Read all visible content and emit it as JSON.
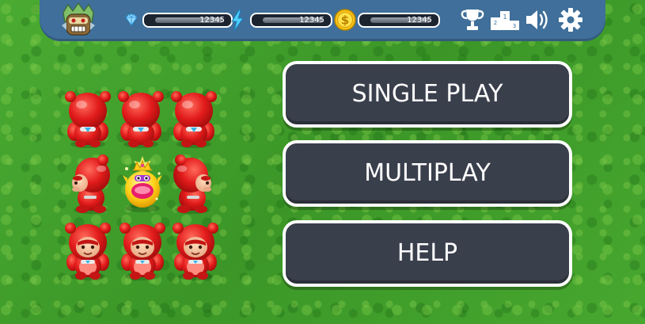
{
  "resources": [
    {
      "name": "gems",
      "icon": "diamond-icon",
      "value": "12345"
    },
    {
      "name": "energy",
      "icon": "lightning-icon",
      "value": "12345"
    },
    {
      "name": "coins",
      "icon": "coin-icon",
      "value": "12345"
    }
  ],
  "top_icons": [
    "trophy-icon",
    "podium-icon",
    "speaker-icon",
    "gear-icon"
  ],
  "menu": {
    "single_play": "SINGLE PLAY",
    "multiplay": "MULTIPLAY",
    "help": "HELP"
  },
  "colors": {
    "grass": "#3f9e2a",
    "topbar": "#3f6f9a",
    "button_bg": "#3a3f4c",
    "button_border": "#ffffff",
    "character_red": "#e21b1b"
  }
}
